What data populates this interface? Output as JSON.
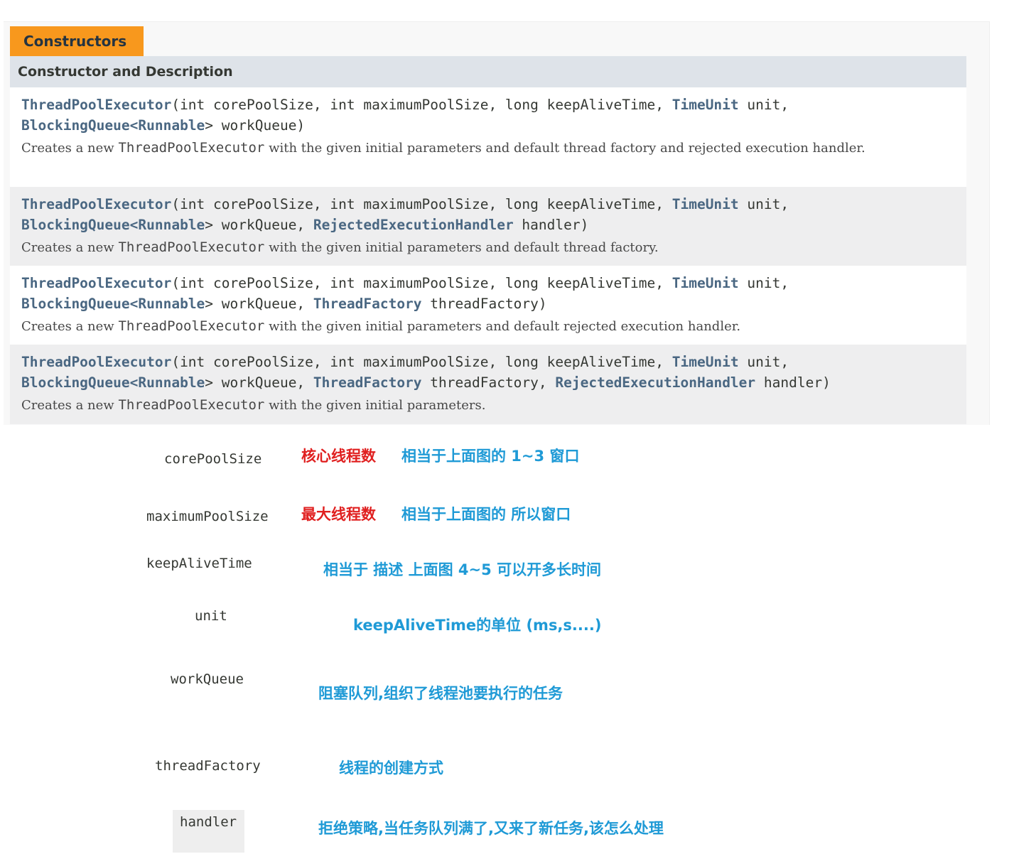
{
  "caption": "Constructors",
  "header": "Constructor and Description",
  "constructors": [
    {
      "name": "ThreadPoolExecutor",
      "p_core": "(int corePoolSize, int maximumPoolSize, long keepAliveTime, ",
      "time_unit": "TimeUnit",
      "unit_end": " unit,",
      "blocking_queue": "BlockingQueue",
      "lt": "<",
      "runnable": "Runnable",
      "work_queue": "> workQueue)",
      "desc_pre": "Creates a new ",
      "desc_code": "ThreadPoolExecutor",
      "desc_post": " with the given initial parameters and default thread factory and rejected execution handler."
    },
    {
      "name": "ThreadPoolExecutor",
      "p_core": "(int corePoolSize, int maximumPoolSize, long keepAliveTime, ",
      "time_unit": "TimeUnit",
      "unit_end": " unit,",
      "blocking_queue": "BlockingQueue",
      "lt": "<",
      "runnable": "Runnable",
      "work_queue": "> workQueue, ",
      "rejected": "RejectedExecutionHandler",
      "handler_end": " handler)",
      "desc_pre": "Creates a new ",
      "desc_code": "ThreadPoolExecutor",
      "desc_post": " with the given initial parameters and default thread factory."
    },
    {
      "name": "ThreadPoolExecutor",
      "p_core": "(int corePoolSize, int maximumPoolSize, long keepAliveTime, ",
      "time_unit": "TimeUnit",
      "unit_end": " unit,",
      "blocking_queue": "BlockingQueue",
      "lt": "<",
      "runnable": "Runnable",
      "work_queue": "> workQueue, ",
      "thread_factory": "ThreadFactory",
      "factory_end": " threadFactory)",
      "desc_pre": "Creates a new ",
      "desc_code": "ThreadPoolExecutor",
      "desc_post": " with the given initial parameters and default rejected execution handler."
    },
    {
      "name": "ThreadPoolExecutor",
      "p_core": "(int corePoolSize, int maximumPoolSize, long keepAliveTime, ",
      "time_unit": "TimeUnit",
      "unit_end": " unit,",
      "blocking_queue": "BlockingQueue",
      "lt": "<",
      "runnable": "Runnable",
      "work_queue": "> workQueue, ",
      "thread_factory": "ThreadFactory",
      "factory_mid": " threadFactory, ",
      "rejected": "RejectedExecutionHandler",
      "handler_end": " handler)",
      "desc_pre": "Creates a new ",
      "desc_code": "ThreadPoolExecutor",
      "desc_post": " with the given initial parameters."
    }
  ],
  "params": [
    {
      "name": "corePoolSize",
      "red": "核心线程数",
      "blue": "相当于上面图的 1~3 窗口"
    },
    {
      "name": "maximumPoolSize",
      "red": "最大线程数",
      "blue": "相当于上面图的 所以窗口"
    },
    {
      "name": "keepAliveTime",
      "blue": "相当于 描述 上面图 4~5 可以开多长时间"
    },
    {
      "name": "unit",
      "blue": "keepAliveTime的单位 (ms,s....)"
    },
    {
      "name": "workQueue",
      "blue": "阻塞队列,组织了线程池要执行的任务"
    },
    {
      "name": "threadFactory",
      "blue": "线程的创建方式"
    },
    {
      "name": "handler",
      "blue": "拒绝策略,当任务队列满了,又来了新任务,该怎么处理"
    }
  ],
  "colors": {
    "accent": "#f8981d",
    "link": "#4a6782",
    "red_note": "#e02020",
    "blue_note": "#1f9ad6"
  }
}
